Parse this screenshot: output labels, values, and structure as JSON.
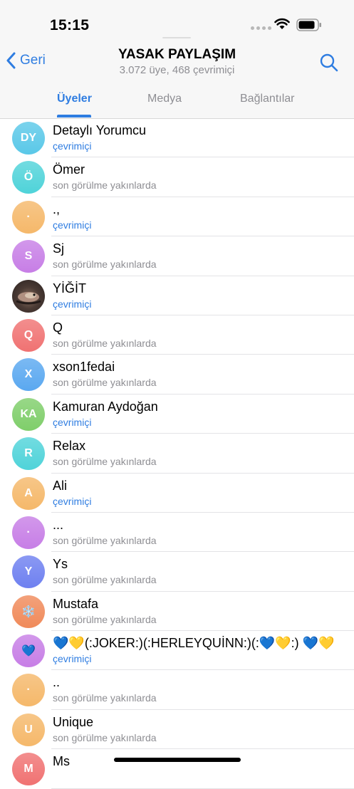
{
  "status_bar": {
    "time": "15:15"
  },
  "nav": {
    "back_label": "Geri",
    "title": "YASAK PAYLAŞIM",
    "subtitle": "3.072 üye, 468 çevrimiçi"
  },
  "tabs": [
    {
      "label": "Üyeler",
      "active": true
    },
    {
      "label": "Medya",
      "active": false
    },
    {
      "label": "Bağlantılar",
      "active": false
    }
  ],
  "members": [
    {
      "initials": "DY",
      "name": "Detaylı Yorumcu",
      "status": "çevrimiçi",
      "online": true,
      "color": "#5ac8e8"
    },
    {
      "initials": "Ö",
      "name": "Ömer",
      "status": "son görülme yakınlarda",
      "online": false,
      "color": "#4fd3d9"
    },
    {
      "initials": "·",
      "name": ".,",
      "status": "çevrimiçi",
      "online": true,
      "color": "#f5b86a"
    },
    {
      "initials": "S",
      "name": "Sj",
      "status": "son görülme yakınlarda",
      "online": false,
      "color": "#c77ee6"
    },
    {
      "initials": "",
      "name": "YİĞİT",
      "status": "çevrimiçi",
      "online": true,
      "color": "#6b5a52",
      "photo": "bird"
    },
    {
      "initials": "Q",
      "name": "Q",
      "status": "son görülme yakınlarda",
      "online": false,
      "color": "#f07272"
    },
    {
      "initials": "X",
      "name": "xson1fedai",
      "status": "son görülme yakınlarda",
      "online": false,
      "color": "#5aa8f0"
    },
    {
      "initials": "KA",
      "name": "Kamuran Aydoğan",
      "status": "çevrimiçi",
      "online": true,
      "color": "#7fce6a"
    },
    {
      "initials": "R",
      "name": "Relax",
      "status": "son görülme yakınlarda",
      "online": false,
      "color": "#4fd3d9"
    },
    {
      "initials": "A",
      "name": "Ali",
      "status": "çevrimiçi",
      "online": true,
      "color": "#f5b86a"
    },
    {
      "initials": "·",
      "name": "...",
      "status": "son görülme yakınlarda",
      "online": false,
      "color": "#c77ee6"
    },
    {
      "initials": "Y",
      "name": "Ys",
      "status": "son görülme yakınlarda",
      "online": false,
      "color": "#6e80f0"
    },
    {
      "initials": "❄️",
      "name": "Mustafa",
      "status": "son görülme yakınlarda",
      "online": false,
      "color": "#f08a5a"
    },
    {
      "initials": "💙",
      "name": "💙💛(:JOKER:)(:HERLEYQUİNN:)(:💙💛:) 💙💛",
      "status": "çevrimiçi",
      "online": true,
      "color": "#c77ee6"
    },
    {
      "initials": "·",
      "name": "..",
      "status": "son görülme yakınlarda",
      "online": false,
      "color": "#f5b86a"
    },
    {
      "initials": "U",
      "name": "Unique",
      "status": "son görülme yakınlarda",
      "online": false,
      "color": "#f5b86a"
    },
    {
      "initials": "M",
      "name": "Ms",
      "status": "",
      "online": false,
      "color": "#f07272"
    }
  ]
}
